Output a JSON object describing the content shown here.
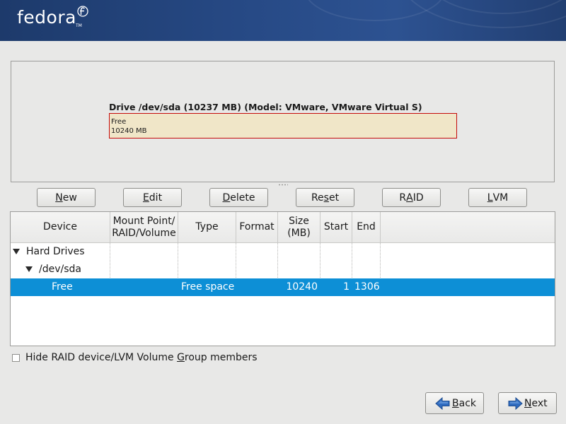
{
  "banner": {
    "logo_text": "fedora",
    "trademark": "TM",
    "bg_color": "#274a86"
  },
  "drive": {
    "title": "Drive /dev/sda (10237 MB) (Model: VMware, VMware Virtual S)",
    "segment_label": "Free",
    "segment_size": "10240 MB",
    "segment_fill": "#f0e6c8",
    "segment_border": "#c40a0a"
  },
  "actions": {
    "new": {
      "pre": "",
      "ul": "N",
      "post": "ew"
    },
    "edit": {
      "pre": "",
      "ul": "E",
      "post": "dit"
    },
    "delete": {
      "pre": "",
      "ul": "D",
      "post": "elete"
    },
    "reset": {
      "pre": "Re",
      "ul": "s",
      "post": "et"
    },
    "raid": {
      "pre": "R",
      "ul": "A",
      "post": "ID"
    },
    "lvm": {
      "pre": "",
      "ul": "L",
      "post": "VM"
    }
  },
  "table": {
    "headers": {
      "device": "Device",
      "mount_1": "Mount Point/",
      "mount_2": "RAID/Volume",
      "type": "Type",
      "format": "Format",
      "size_1": "Size",
      "size_2": "(MB)",
      "start": "Start",
      "end": "End"
    },
    "rows": [
      {
        "device": "Hard Drives"
      },
      {
        "device": "/dev/sda"
      },
      {
        "device": "Free",
        "type": "Free space",
        "size": "10240",
        "start": "1",
        "end": "1306"
      }
    ],
    "selection_color": "#0d8fd6"
  },
  "options": {
    "hide_pre": "Hide RAID device/LVM Volume ",
    "hide_ul": "G",
    "hide_post": "roup members",
    "hide_checked": false
  },
  "nav": {
    "back": {
      "ul": "B",
      "post": "ack"
    },
    "next": {
      "ul": "N",
      "post": "ext"
    },
    "icon_back": "left-arrow-icon",
    "icon_next": "right-arrow-icon",
    "arrow_color": "#2f6bbf"
  }
}
